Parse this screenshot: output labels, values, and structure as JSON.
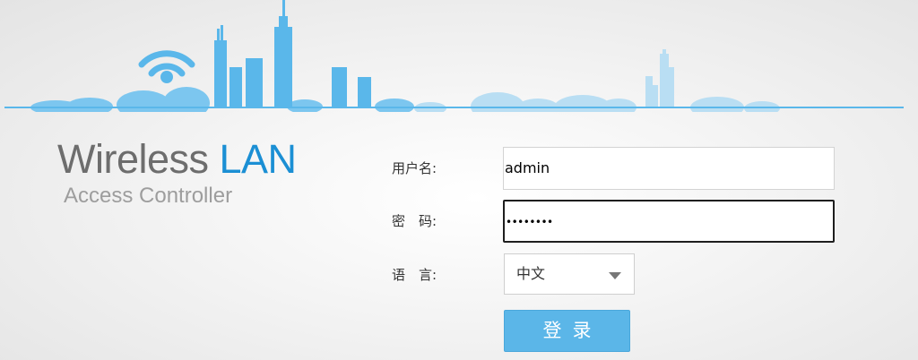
{
  "brand": {
    "title_main": "Wireless ",
    "title_accent": "LAN",
    "subtitle": "Access Controller"
  },
  "form": {
    "username_label": "用户名:",
    "username_value": "admin",
    "password_label": "密　码:",
    "password_masked": "••••••••",
    "language_label": "语　言:",
    "language_value": "中文",
    "login_label": "登录"
  },
  "colors": {
    "accent": "#1b8fd4",
    "skyline": "#5ab7ea",
    "button": "#5bb6e8"
  }
}
